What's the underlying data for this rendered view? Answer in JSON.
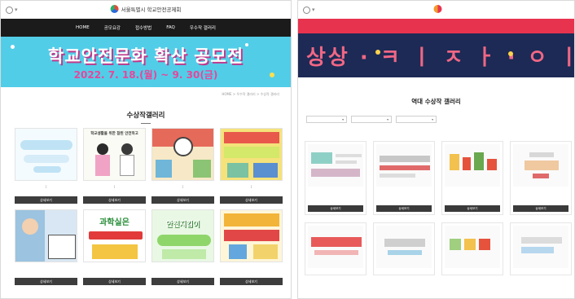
{
  "left_site": {
    "header": {
      "org_logo_text": "서울특별시 학교안전공제회"
    },
    "nav": [
      "HOME",
      "공모요강",
      "접수방법",
      "FAQ",
      "우수작 갤러리"
    ],
    "banner": {
      "title": "학교안전문화 확산 공모전",
      "date": "2022. 7. 18.(월) ~ 9. 30(금)"
    },
    "breadcrumb": "HOME > 우수작 갤러리 > 수상작 갤러리",
    "section_title": "수상작갤러리",
    "cards": [
      {
        "thumb_text": "",
        "tag": "[",
        "desc": "",
        "button": "상세보기"
      },
      {
        "thumb_text": "학교생활을 위한 참된 안전하고",
        "tag": "[",
        "desc": "",
        "button": "상세보기"
      },
      {
        "thumb_text": "",
        "tag": "[",
        "desc": "",
        "button": "상세보기"
      },
      {
        "thumb_text": "",
        "tag": "[",
        "desc": "",
        "button": "상세보기"
      },
      {
        "thumb_text": "과학실은",
        "tag": "",
        "desc": "",
        "button": "상세보기"
      },
      {
        "thumb_text": "안전지킴이",
        "tag": "",
        "desc": "",
        "button": "상세보기"
      },
      {
        "thumb_text": "",
        "tag": "",
        "desc": "",
        "button": "상세보기"
      },
      {
        "thumb_text": "",
        "tag": "",
        "desc": "",
        "button": "상세보기"
      }
    ]
  },
  "right_site": {
    "header": {
      "org_logo_text": ""
    },
    "nav": [
      "",
      "",
      "",
      "",
      ""
    ],
    "banner": {
      "title": "상상 · ㅋ ㅣ ㅈ ㅏ · ㅇ ㅣ"
    },
    "breadcrumb": "",
    "section_title": "역대 수상작 갤러리",
    "filters": [
      "",
      "",
      ""
    ],
    "cards": [
      {
        "lines": [
          "",
          "",
          "",
          ""
        ],
        "button": "상세보기"
      },
      {
        "lines": [
          "",
          "",
          "",
          ""
        ],
        "button": "상세보기"
      },
      {
        "lines": [
          "",
          "",
          "",
          ""
        ],
        "button": "상세보기"
      },
      {
        "lines": [
          "",
          "",
          "",
          ""
        ],
        "button": "상세보기"
      },
      {
        "lines": [
          ""
        ],
        "button": ""
      },
      {
        "lines": [
          ""
        ],
        "button": ""
      },
      {
        "lines": [
          ""
        ],
        "button": ""
      },
      {
        "lines": [
          ""
        ],
        "button": ""
      }
    ]
  },
  "colors": {
    "left_nav_bg": "#1b1b1b",
    "left_banner_bg": "#52cde8",
    "left_banner_accent": "#e5479b",
    "right_nav_bg": "#e8334f",
    "right_banner_bg": "#1c2a55",
    "right_banner_text": "#f06785"
  }
}
